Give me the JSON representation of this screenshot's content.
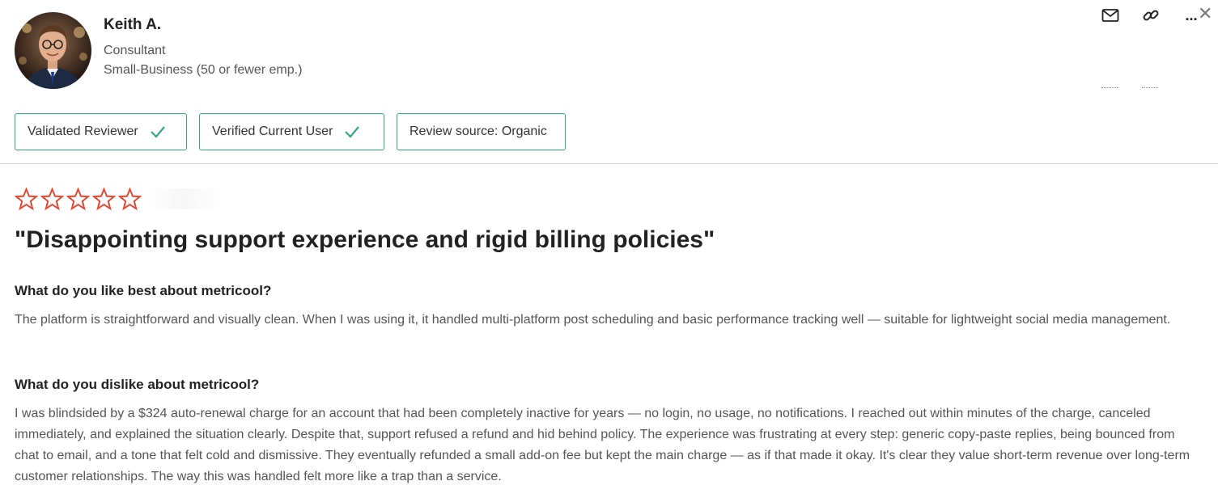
{
  "reviewer": {
    "name": "Keith A.",
    "role": "Consultant",
    "company_size": "Small-Business (50 or fewer emp.)"
  },
  "badges": [
    {
      "label": "Validated Reviewer",
      "checked": true
    },
    {
      "label": "Verified Current User",
      "checked": true
    },
    {
      "label": "Review source: Organic",
      "checked": false
    }
  ],
  "rating": {
    "stars_filled": 0,
    "stars_total": 5,
    "star_color": "#e8442f"
  },
  "review": {
    "title": "\"Disappointing support experience and rigid billing policies\"",
    "questions": [
      {
        "question": "What do you like best about metricool?",
        "answer": "The platform is straightforward and visually clean. When I was using it, it handled multi-platform post scheduling and basic performance tracking well — suitable for lightweight social media management."
      },
      {
        "question": "What do you dislike about metricool?",
        "answer": "I was blindsided by a $324 auto-renewal charge for an account that had been completely inactive for years — no login, no usage, no notifications. I reached out within minutes of the charge, canceled immediately, and explained the situation clearly. Despite that, support refused a refund and hid behind policy. The experience was frustrating at every step: generic copy-paste replies, being bounced from chat to email, and a tone that felt cold and dismissive. They eventually refunded a small add-on fee but kept the main charge — as if that made it okay. It's clear they value short-term revenue over long-term customer relationships. The way this was handled felt more like a trap than a service."
      }
    ]
  },
  "toolbar": {
    "icons": [
      "mail-icon",
      "link-icon",
      "more-icon",
      "close-icon"
    ],
    "more_label": "...",
    "close_label": "✕"
  },
  "colors": {
    "badge_border": "#2fa884",
    "check": "#2fa884",
    "star": "#e8442f"
  }
}
